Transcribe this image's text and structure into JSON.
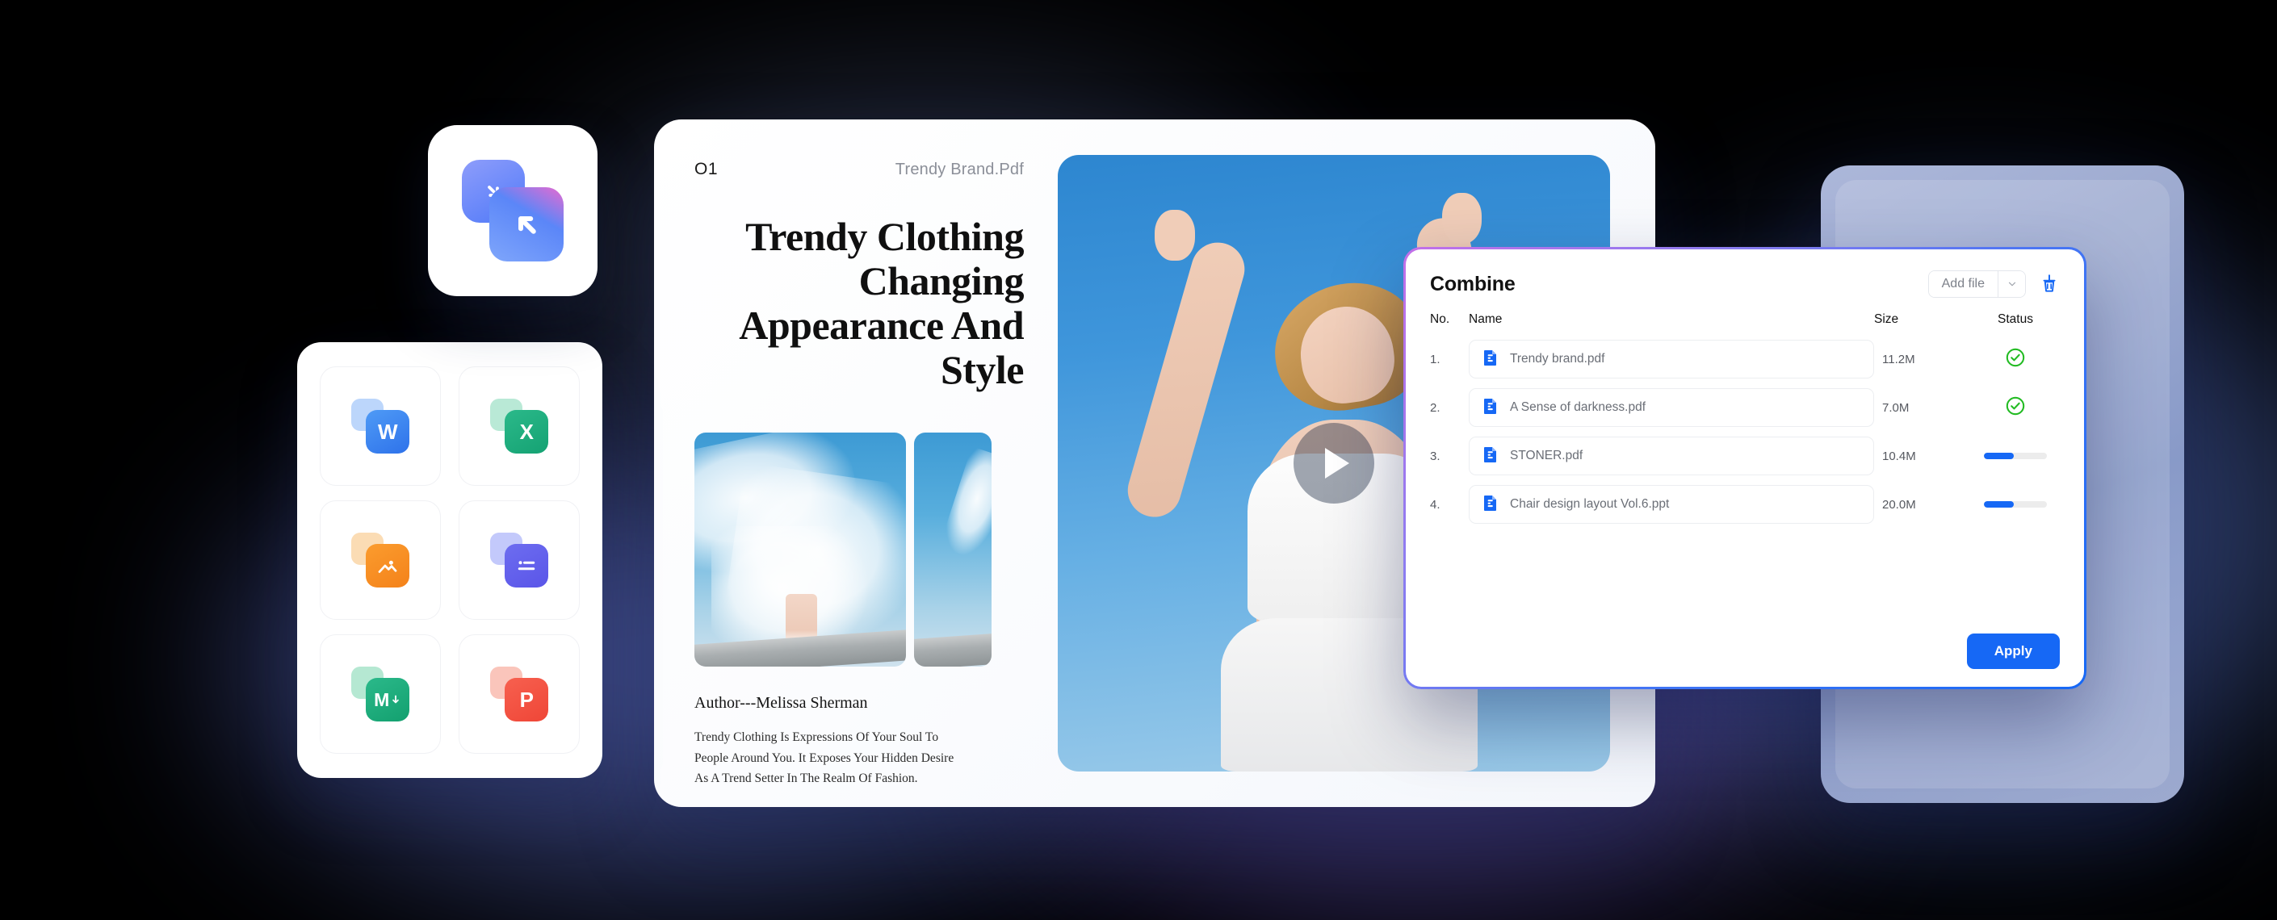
{
  "logo": {
    "name": "combine-merge-logo"
  },
  "formats": {
    "items": [
      {
        "name": "word",
        "label": "W",
        "back": "#bcd6fb",
        "front_from": "#4f9bf6",
        "front_to": "#2e72ea",
        "icon": "word-icon"
      },
      {
        "name": "excel",
        "label": "X",
        "back": "#b9e9d6",
        "front_from": "#2bb98a",
        "front_to": "#15a273",
        "icon": "excel-icon"
      },
      {
        "name": "image",
        "label": "",
        "back": "#fbdcb4",
        "front_from": "#fb9c2e",
        "front_to": "#f4821a",
        "icon": "image-icon"
      },
      {
        "name": "text",
        "label": "",
        "back": "#c3c9fb",
        "front_from": "#6d6df0",
        "front_to": "#5a55e8",
        "icon": "text-document-icon"
      },
      {
        "name": "markdown",
        "label": "M",
        "back": "#b5e8d2",
        "front_from": "#2bb98a",
        "front_to": "#13a06f",
        "icon": "markdown-icon"
      },
      {
        "name": "powerpoint",
        "label": "P",
        "back": "#fac5bb",
        "front_from": "#f7604f",
        "front_to": "#ef4637",
        "icon": "powerpoint-icon"
      }
    ]
  },
  "document": {
    "page_number": "O1",
    "filename": "Trendy Brand.Pdf",
    "title": "Trendy Clothing Changing Appearance And Style",
    "author": "Author---Melissa Sherman",
    "body": "Trendy Clothing Is Expressions Of Your Soul To People Around You. It Exposes Your Hidden Desire As A Trend Setter In The Realm Of Fashion.",
    "play_label": "play-video"
  },
  "combine": {
    "title": "Combine",
    "add_file_label": "Add file",
    "dropdown_icon": "chevron-down-icon",
    "clear_icon": "broom-clear-icon",
    "columns": {
      "no": "No.",
      "name": "Name",
      "size": "Size",
      "status": "Status"
    },
    "apply_label": "Apply",
    "accent": "#1668f5",
    "success_color": "#22bb22",
    "rows": [
      {
        "no": "1.",
        "name": "Trendy brand.pdf",
        "size": "11.2M",
        "status": "done",
        "progress": 100
      },
      {
        "no": "2.",
        "name": "A Sense of darkness.pdf",
        "size": "7.0M",
        "status": "done",
        "progress": 100
      },
      {
        "no": "3.",
        "name": "STONER.pdf",
        "size": "10.4M",
        "status": "in-progress",
        "progress": 48
      },
      {
        "no": "4.",
        "name": "Chair design layout Vol.6.ppt",
        "size": "20.0M",
        "status": "in-progress",
        "progress": 48
      }
    ]
  }
}
